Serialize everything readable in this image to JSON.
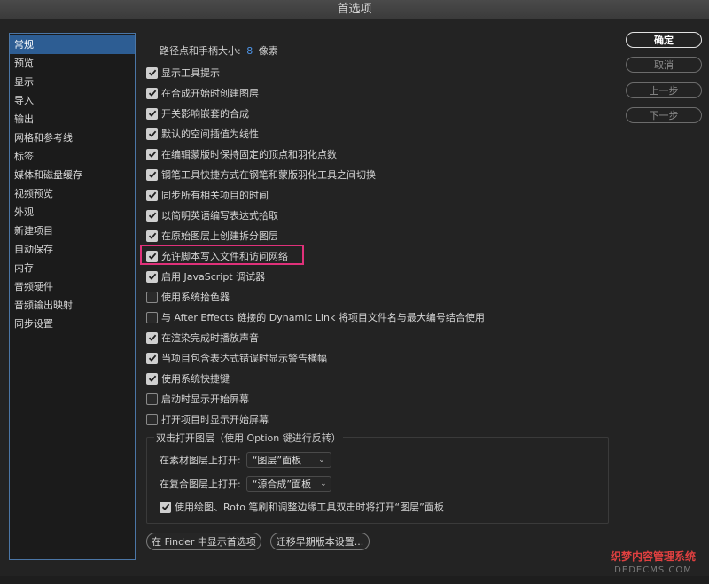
{
  "window": {
    "title": "首选项"
  },
  "sidebar": {
    "items": [
      {
        "label": "常规",
        "selected": true
      },
      {
        "label": "预览"
      },
      {
        "label": "显示"
      },
      {
        "label": "导入"
      },
      {
        "label": "输出"
      },
      {
        "label": "网格和参考线"
      },
      {
        "label": "标签"
      },
      {
        "label": "媒体和磁盘缓存"
      },
      {
        "label": "视频预览"
      },
      {
        "label": "外观"
      },
      {
        "label": "新建项目"
      },
      {
        "label": "自动保存"
      },
      {
        "label": "内存"
      },
      {
        "label": "音频硬件"
      },
      {
        "label": "音频输出映射"
      },
      {
        "label": "同步设置"
      }
    ]
  },
  "general": {
    "path_size_label": "路径点和手柄大小:",
    "path_size_value": "8",
    "path_size_unit": "像素",
    "options": [
      {
        "label": "显示工具提示",
        "checked": true
      },
      {
        "label": "在合成开始时创建图层",
        "checked": true
      },
      {
        "label": "开关影响嵌套的合成",
        "checked": true
      },
      {
        "label": "默认的空间插值为线性",
        "checked": true
      },
      {
        "label": "在编辑蒙版时保持固定的顶点和羽化点数",
        "checked": true
      },
      {
        "label": "钢笔工具快捷方式在钢笔和蒙版羽化工具之间切换",
        "checked": true
      },
      {
        "label": "同步所有相关项目的时间",
        "checked": true
      },
      {
        "label": "以简明英语编写表达式拾取",
        "checked": true
      },
      {
        "label": "在原始图层上创建拆分图层",
        "checked": true
      },
      {
        "label": "允许脚本写入文件和访问网络",
        "checked": true
      },
      {
        "label": "启用 JavaScript 调试器",
        "checked": true
      },
      {
        "label": "使用系统拾色器",
        "checked": false
      },
      {
        "label": "与 After Effects 链接的 Dynamic Link 将项目文件名与最大编号结合使用",
        "checked": false
      },
      {
        "label": "在渲染完成时播放声音",
        "checked": true
      },
      {
        "label": "当项目包含表达式错误时显示警告横幅",
        "checked": true
      },
      {
        "label": "使用系统快捷键",
        "checked": true
      },
      {
        "label": "启动时显示开始屏幕",
        "checked": false
      },
      {
        "label": "打开项目时显示开始屏幕",
        "checked": false
      }
    ],
    "double_click_group": {
      "title": "双击打开图层（使用 Option 键进行反转）",
      "footage_label": "在素材图层上打开:",
      "footage_value": "“图层”面板",
      "comp_label": "在复合图层上打开:",
      "comp_value": "“源合成”面板",
      "paint_option": {
        "label": "使用绘图、Roto 笔刷和调整边缘工具双击时将打开“图层”面板",
        "checked": true
      }
    },
    "reveal_in_finder_label": "在 Finder 中显示首选项",
    "migrate_label": "迁移早期版本设置..."
  },
  "buttons": {
    "ok": "确定",
    "cancel": "取消",
    "previous": "上一步",
    "next": "下一步"
  },
  "watermark": {
    "line1": "织梦内容管理系统",
    "line2": "DEDECMS.COM"
  },
  "colors": {
    "accent": "#2d5d93",
    "value_blue": "#4d93e5",
    "highlight": "#e0317a"
  }
}
